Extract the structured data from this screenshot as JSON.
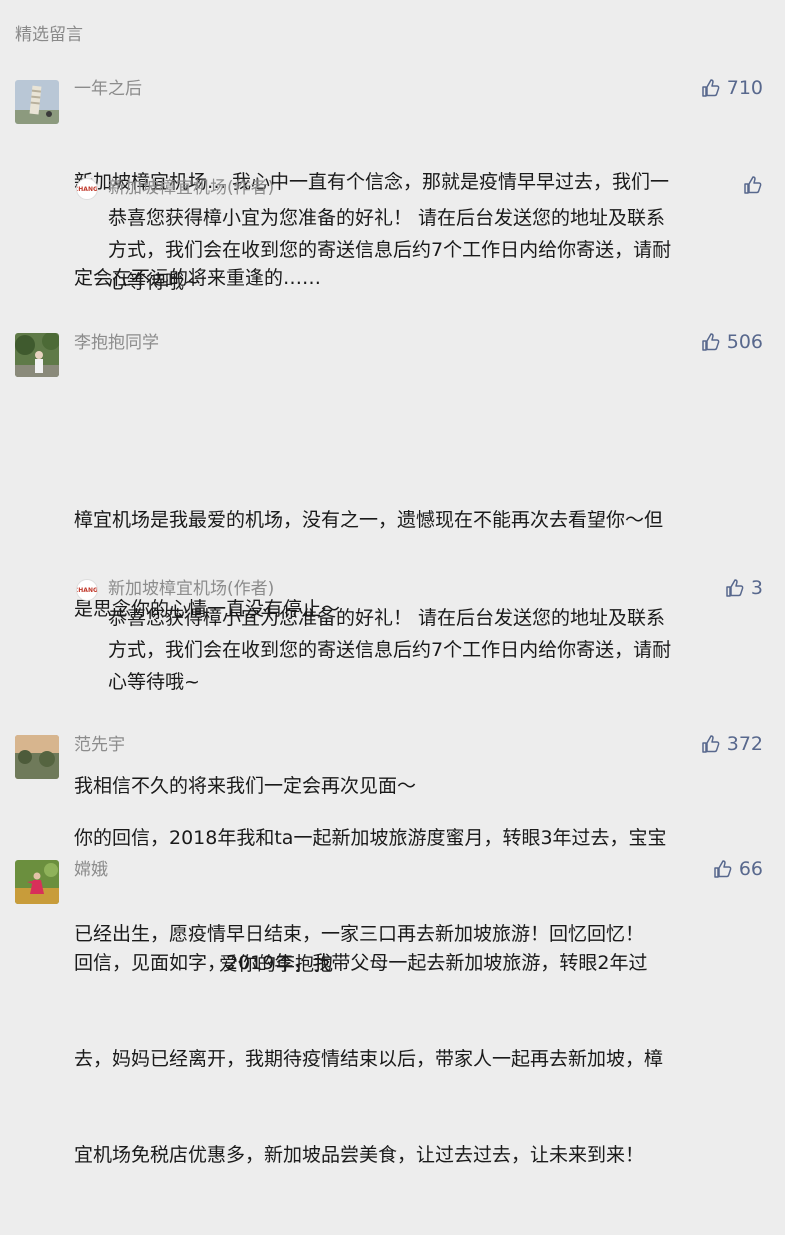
{
  "section_title": "精选留言",
  "comments": [
    {
      "nickname": "一年之后",
      "likes": "710",
      "lines": [
        "新加坡樟宜机场… 我心中一直有个信念，那就是疫情早早过去，我们一",
        "定会在不远的将来重逢的……"
      ],
      "reply": {
        "logo_text": "CHANGI",
        "name": "新加坡樟宜机场(作者)",
        "likes": "",
        "lines": [
          "恭喜您获得樟小宜为您准备的好礼！ 请在后台发送您的地址及联系",
          "方式，我们会在收到您的寄送信息后约7个工作日内给你寄送，请耐",
          "心等待哦~"
        ]
      }
    },
    {
      "nickname": "李抱抱同学",
      "likes": "506",
      "lines": [
        "",
        "樟宜机场是我最爱的机场，没有之一，遗憾现在不能再次去看望你～但",
        "是思念你的心情一直没有停止～",
        "",
        "我相信不久的将来我们一定会再次见面～",
        "",
        "                        爱你的李抱抱"
      ],
      "reply": {
        "logo_text": "CHANGI",
        "name": "新加坡樟宜机场(作者)",
        "likes": "3",
        "lines": [
          "恭喜您获得樟小宜为您准备的好礼！ 请在后台发送您的地址及联系",
          "方式，我们会在收到您的寄送信息后约7个工作日内给你寄送，请耐",
          "心等待哦~"
        ]
      }
    },
    {
      "nickname": "范先宇",
      "likes": "372",
      "lines": [
        "你的回信，2018年我和ta一起新加坡旅游度蜜月，转眼3年过去，宝宝",
        "已经出生，愿疫情早日结束，一家三口再去新加坡旅游！回忆回忆！"
      ]
    },
    {
      "nickname": "嫦娥",
      "likes": "66",
      "lines": [
        "回信，见面如字，2019年，我带父母一起去新加坡旅游，转眼2年过",
        "去，妈妈已经离开，我期待疫情结束以后，带家人一起再去新加坡，樟",
        "宜机场免税店优惠多，新加坡品尝美食，让过去过去，让未来到来！"
      ]
    }
  ],
  "colors": {
    "background": "#ededed",
    "like_color": "#58688d",
    "meta_gray": "#8c8c8c"
  },
  "icons": {
    "like": "thumbs-up-icon"
  }
}
